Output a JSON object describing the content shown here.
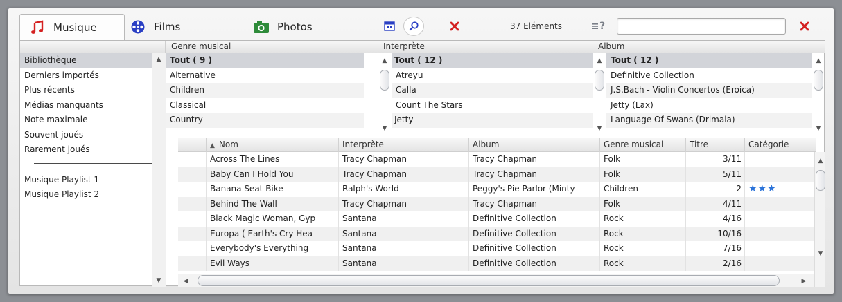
{
  "tabs": [
    {
      "label": "Musique",
      "icon": "music-note-icon",
      "active": true
    },
    {
      "label": "Films",
      "icon": "film-reel-icon",
      "active": false
    },
    {
      "label": "Photos",
      "icon": "camera-icon",
      "active": false
    }
  ],
  "toolbar": {
    "count": "37 Eléments",
    "help_label": "?",
    "search_value": "",
    "search_placeholder": ""
  },
  "sidebar": {
    "items": [
      "Bibliothèque",
      "Derniers importés",
      "Plus récents",
      "Médias manquants",
      "Note maximale",
      "Souvent joués",
      "Rarement joués"
    ],
    "selected_index": 0,
    "playlists": [
      "Musique Playlist 1",
      "Musique Playlist 2"
    ]
  },
  "browsers": {
    "genre": {
      "header": "Genre musical",
      "items": [
        "Tout ( 9 )",
        "Alternative",
        "Children",
        "Classical",
        "Country"
      ]
    },
    "artist": {
      "header": "Interprète",
      "items": [
        "Tout ( 12 )",
        "Atreyu",
        "Calla",
        "Count The Stars",
        "Jetty"
      ]
    },
    "album": {
      "header": "Album",
      "items": [
        "Tout ( 12 )",
        "Definitive Collection",
        "J.S.Bach - Violin Concertos (Eroica)",
        "Jetty (Lax)",
        "Language Of Swans (Drimala)"
      ]
    }
  },
  "tracks": {
    "sort_indicator": "▲",
    "columns": [
      "Nom",
      "Interprète",
      "Album",
      "Genre musical",
      "Titre",
      "Catégorie"
    ],
    "rows": [
      {
        "name": "Across The Lines",
        "artist": "Tracy Chapman",
        "album": "Tracy Chapman",
        "genre": "Folk",
        "track": "3/11",
        "rating": ""
      },
      {
        "name": "Baby Can I Hold You",
        "artist": "Tracy Chapman",
        "album": "Tracy Chapman",
        "genre": "Folk",
        "track": "5/11",
        "rating": ""
      },
      {
        "name": "Banana Seat Bike",
        "artist": "Ralph's World",
        "album": "Peggy's Pie Parlor (Minty",
        "genre": "Children",
        "track": "2",
        "rating": "★★★"
      },
      {
        "name": "Behind The Wall",
        "artist": "Tracy Chapman",
        "album": "Tracy Chapman",
        "genre": "Folk",
        "track": "4/11",
        "rating": ""
      },
      {
        "name": "Black Magic Woman, Gyp",
        "artist": "Santana",
        "album": "Definitive Collection",
        "genre": "Rock",
        "track": "4/16",
        "rating": ""
      },
      {
        "name": "Europa ( Earth's Cry Hea",
        "artist": "Santana",
        "album": "Definitive Collection",
        "genre": "Rock",
        "track": "10/16",
        "rating": ""
      },
      {
        "name": "Everybody's Everything",
        "artist": "Santana",
        "album": "Definitive Collection",
        "genre": "Rock",
        "track": "7/16",
        "rating": ""
      },
      {
        "name": "Evil Ways",
        "artist": "Santana",
        "album": "Definitive Collection",
        "genre": "Rock",
        "track": "2/16",
        "rating": ""
      }
    ]
  },
  "colors": {
    "accent": "#2b73d9",
    "close": "#d42020",
    "selection": "#d2d4d9"
  }
}
